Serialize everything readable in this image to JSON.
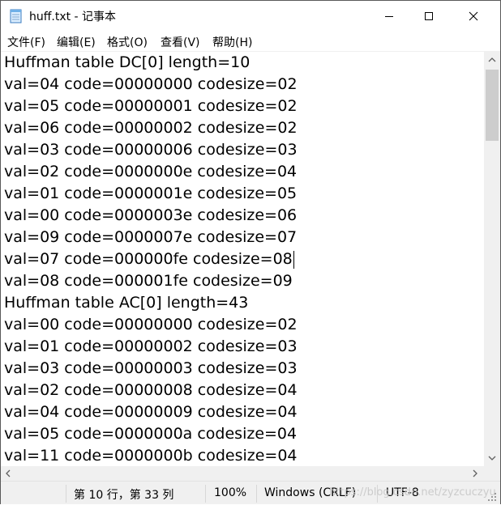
{
  "window": {
    "title": "huff.txt - 记事本",
    "icons": {
      "app": "notepad-icon",
      "minimize": "minimize-icon",
      "maximize": "maximize-icon",
      "close": "close-icon"
    }
  },
  "menu": [
    "文件(F)",
    "编辑(E)",
    "格式(O)",
    "查看(V)",
    "帮助(H)"
  ],
  "lines": [
    "Huffman table DC[0] length=10",
    "val=04 code=00000000 codesize=02",
    "val=05 code=00000001 codesize=02",
    "val=06 code=00000002 codesize=02",
    "val=03 code=00000006 codesize=03",
    "val=02 code=0000000e codesize=04",
    "val=01 code=0000001e codesize=05",
    "val=00 code=0000003e codesize=06",
    "val=09 code=0000007e codesize=07",
    "val=07 code=000000fe codesize=08",
    "val=08 code=000001fe codesize=09",
    "Huffman table AC[0] length=43",
    "val=00 code=00000000 codesize=02",
    "val=01 code=00000002 codesize=03",
    "val=03 code=00000003 codesize=03",
    "val=02 code=00000008 codesize=04",
    "val=04 code=00000009 codesize=04",
    "val=05 code=0000000a codesize=04",
    "val=11 code=0000000b codesize=04"
  ],
  "status": {
    "position": "第 10 行，第 33 列",
    "zoom": "100%",
    "line_ending": "Windows (CRLF)",
    "encoding": "UTF-8",
    "watermark": "https://blog.csdn.net/zyzcuczyu"
  },
  "colors": {
    "scroll_track": "#f0f0f0",
    "scroll_thumb": "#cdcdcd",
    "status_bg": "#f0f0f0"
  }
}
